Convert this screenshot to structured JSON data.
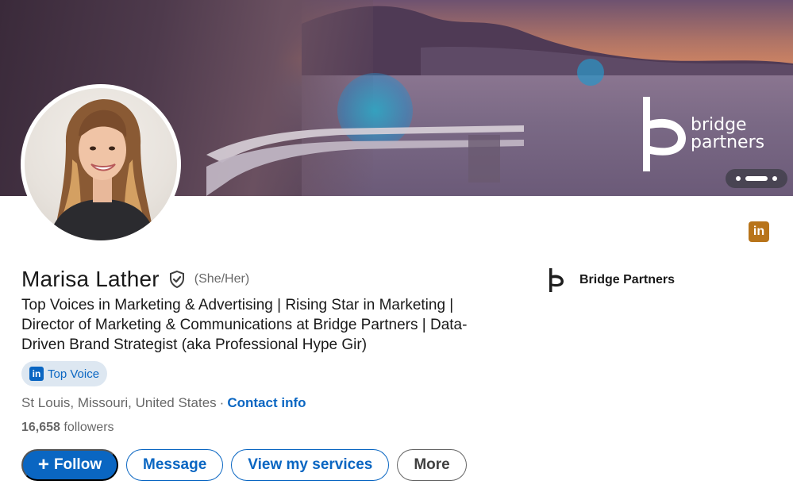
{
  "banner": {
    "brand_line1": "bridge",
    "brand_line2": "partners"
  },
  "profile": {
    "name": "Marisa Lather",
    "pronouns": "(She/Her)",
    "headline": "Top Voices in Marketing & Advertising | Rising Star in Marketing | Director of Marketing & Communications at Bridge Partners | Data-Driven Brand Strategist (aka Professional Hype Gir)",
    "badge_label": "Top Voice",
    "location": "St Louis, Missouri, United States",
    "separator": "·",
    "contact_label": "Contact info",
    "followers_count": "16,658",
    "followers_label": "followers"
  },
  "company": {
    "name": "Bridge Partners"
  },
  "actions": {
    "follow_label": "Follow",
    "message_label": "Message",
    "services_label": "View my services",
    "more_label": "More"
  },
  "icons": {
    "linkedin_mark": "in",
    "plus": "+"
  },
  "colors": {
    "brand_blue": "#0a66c2",
    "linkedin_corner": "#b8741a",
    "badge_bg": "#dde7f1"
  }
}
